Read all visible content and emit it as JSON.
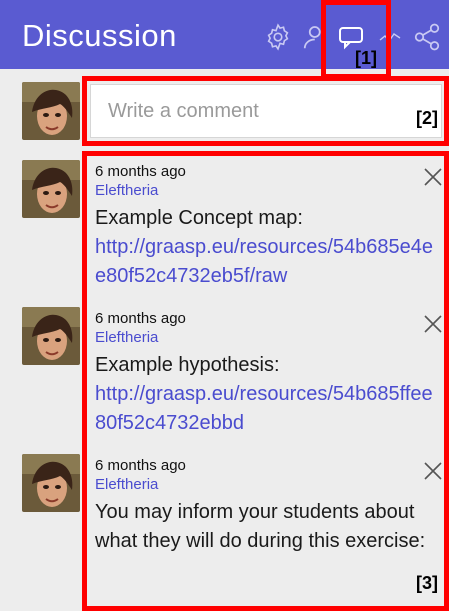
{
  "header": {
    "title": "Discussion",
    "background": "#5a5bd1",
    "icons": [
      "gear-icon",
      "users-icon",
      "comment-icon",
      "activity-icon",
      "share-icon"
    ]
  },
  "comment_input": {
    "placeholder": "Write a comment",
    "value": ""
  },
  "comments": [
    {
      "time": "6 months ago",
      "author": "Eleftheria",
      "text": "Example Concept map:",
      "link": "http://graasp.eu/resources/54b685e4ee80f52c4732eb5f/raw"
    },
    {
      "time": "6 months ago",
      "author": "Eleftheria",
      "text": "Example hypothesis:",
      "link": "http://graasp.eu/resources/54b685ffee80f52c4732ebbd"
    },
    {
      "time": "6 months ago",
      "author": "Eleftheria",
      "text": "You may inform your students about what they will do during this exercise:",
      "link": ""
    }
  ],
  "annotations": {
    "a1": "[1]",
    "a2": "[2]",
    "a3": "[3]"
  },
  "colors": {
    "accent": "#5a5bd1",
    "link": "#4a4ccf",
    "annotation": "#ff0000"
  }
}
